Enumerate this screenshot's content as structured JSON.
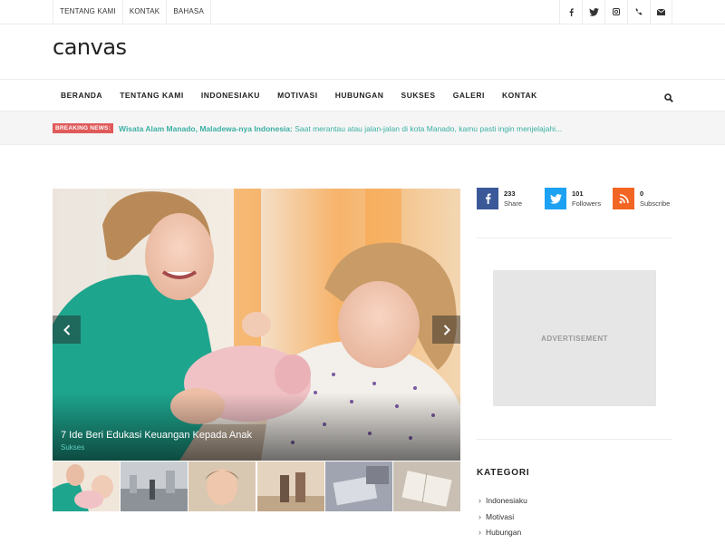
{
  "topbar": {
    "links": [
      "TENTANG KAMI",
      "KONTAK",
      "BAHASA"
    ],
    "social_icons": [
      "facebook-icon",
      "twitter-icon",
      "instagram-icon",
      "phone-icon",
      "email-icon"
    ]
  },
  "logo": "canvas",
  "nav": {
    "items": [
      "BERANDA",
      "TENTANG KAMI",
      "INDONESIAKU",
      "MOTIVASI",
      "HUBUNGAN",
      "SUKSES",
      "GALERI",
      "KONTAK"
    ],
    "search_icon": "search-icon"
  },
  "breaking": {
    "label": "BREAKING NEWS:",
    "headline": "Wisata Alam Manado, Maladewa-nya Indonesia:",
    "excerpt": "Saat merantau atau jalan-jalan di kota Manado, kamu pasti ingin menjelajahi..."
  },
  "slider": {
    "title": "7 Ide Beri Edukasi Keuangan Kepada Anak",
    "category": "Sukses",
    "prev_icon": "chevron-left-icon",
    "next_icon": "chevron-right-icon"
  },
  "sidebar": {
    "social": [
      {
        "icon": "facebook-icon",
        "count": "233",
        "label": "Share",
        "color": "#3b5998"
      },
      {
        "icon": "twitter-icon",
        "count": "101",
        "label": "Followers",
        "color": "#1da1f2"
      },
      {
        "icon": "rss-icon",
        "count": "0",
        "label": "Subscribe",
        "color": "#f26522"
      }
    ],
    "ad_label": "ADVERTISEMENT",
    "kategori_title": "KATEGORI",
    "kategori": [
      "Indonesiaku",
      "Motivasi",
      "Hubungan"
    ]
  },
  "colors": {
    "accent": "#3bb0a3",
    "breaking_red": "#e05a5a"
  }
}
